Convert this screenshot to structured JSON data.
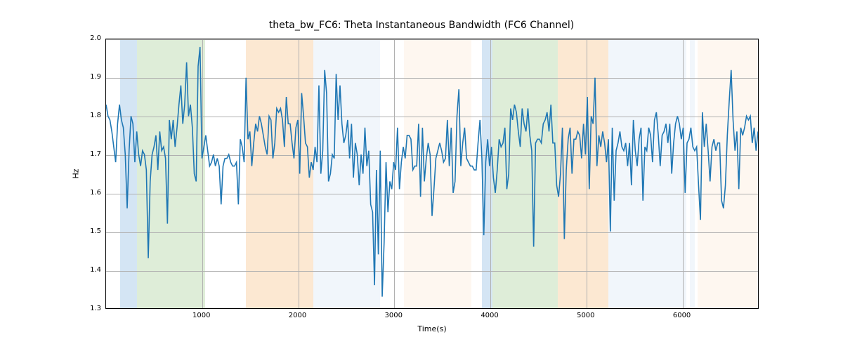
{
  "chart_data": {
    "type": "line",
    "title": "theta_bw_FC6: Theta Instantaneous Bandwidth (FC6 Channel)",
    "xlabel": "Time(s)",
    "ylabel": "Hz",
    "xlim": [
      0,
      6800
    ],
    "ylim": [
      1.3,
      2.0
    ],
    "xticks": [
      1000,
      2000,
      3000,
      4000,
      5000,
      6000
    ],
    "yticks": [
      1.3,
      1.4,
      1.5,
      1.6,
      1.7,
      1.8,
      1.9,
      2.0
    ],
    "bands": [
      {
        "x0": 145,
        "x1": 320,
        "color": "#6fa8dc"
      },
      {
        "x0": 320,
        "x1": 1030,
        "color": "#93c47d"
      },
      {
        "x0": 1455,
        "x1": 2155,
        "color": "#f6b26b"
      },
      {
        "x0": 2155,
        "x1": 2850,
        "color": "#cfe2f3"
      },
      {
        "x0": 3100,
        "x1": 3805,
        "color": "#fbe4cd"
      },
      {
        "x0": 3915,
        "x1": 4025,
        "color": "#6fa8dc"
      },
      {
        "x0": 4025,
        "x1": 4705,
        "color": "#93c47d"
      },
      {
        "x0": 4705,
        "x1": 5225,
        "color": "#f6b26b"
      },
      {
        "x0": 5225,
        "x1": 6040,
        "color": "#cfe2f3"
      },
      {
        "x0": 6075,
        "x1": 6125,
        "color": "#cfe2f3"
      },
      {
        "x0": 6155,
        "x1": 6800,
        "color": "#fbe4cd"
      }
    ],
    "x": [
      0,
      20,
      40,
      60,
      80,
      100,
      120,
      140,
      160,
      180,
      200,
      220,
      240,
      260,
      280,
      300,
      320,
      340,
      360,
      380,
      400,
      420,
      440,
      460,
      480,
      500,
      520,
      540,
      560,
      580,
      600,
      620,
      640,
      660,
      680,
      700,
      720,
      740,
      760,
      780,
      800,
      820,
      840,
      860,
      880,
      900,
      920,
      940,
      960,
      980,
      1000,
      1020,
      1040,
      1060,
      1080,
      1100,
      1120,
      1140,
      1160,
      1180,
      1200,
      1220,
      1240,
      1260,
      1280,
      1300,
      1320,
      1340,
      1360,
      1380,
      1400,
      1420,
      1440,
      1460,
      1480,
      1500,
      1520,
      1540,
      1560,
      1580,
      1600,
      1620,
      1640,
      1660,
      1680,
      1700,
      1720,
      1740,
      1760,
      1780,
      1800,
      1820,
      1840,
      1860,
      1880,
      1900,
      1920,
      1940,
      1960,
      1980,
      2000,
      2020,
      2040,
      2060,
      2080,
      2100,
      2120,
      2140,
      2160,
      2180,
      2200,
      2220,
      2240,
      2260,
      2280,
      2300,
      2320,
      2340,
      2360,
      2380,
      2400,
      2420,
      2440,
      2460,
      2480,
      2500,
      2520,
      2540,
      2560,
      2580,
      2600,
      2620,
      2640,
      2660,
      2680,
      2700,
      2720,
      2740,
      2760,
      2780,
      2800,
      2820,
      2840,
      2860,
      2880,
      2900,
      2920,
      2940,
      2960,
      2980,
      3000,
      3020,
      3040,
      3060,
      3080,
      3100,
      3120,
      3140,
      3160,
      3180,
      3200,
      3220,
      3240,
      3260,
      3280,
      3300,
      3320,
      3340,
      3360,
      3380,
      3400,
      3420,
      3440,
      3460,
      3480,
      3500,
      3520,
      3540,
      3560,
      3580,
      3600,
      3620,
      3640,
      3660,
      3680,
      3700,
      3720,
      3740,
      3760,
      3780,
      3800,
      3820,
      3840,
      3860,
      3880,
      3900,
      3920,
      3940,
      3960,
      3980,
      4000,
      4020,
      4040,
      4060,
      4080,
      4100,
      4120,
      4140,
      4160,
      4180,
      4200,
      4220,
      4240,
      4260,
      4280,
      4300,
      4320,
      4340,
      4360,
      4380,
      4400,
      4420,
      4440,
      4460,
      4480,
      4500,
      4520,
      4540,
      4560,
      4580,
      4600,
      4620,
      4640,
      4660,
      4680,
      4700,
      4720,
      4740,
      4760,
      4780,
      4800,
      4820,
      4840,
      4860,
      4880,
      4900,
      4920,
      4940,
      4960,
      4980,
      5000,
      5020,
      5040,
      5060,
      5080,
      5100,
      5120,
      5140,
      5160,
      5180,
      5200,
      5220,
      5240,
      5260,
      5280,
      5300,
      5320,
      5340,
      5360,
      5380,
      5400,
      5420,
      5440,
      5460,
      5480,
      5500,
      5520,
      5540,
      5560,
      5580,
      5600,
      5620,
      5640,
      5660,
      5680,
      5700,
      5720,
      5740,
      5760,
      5780,
      5800,
      5820,
      5840,
      5860,
      5880,
      5900,
      5920,
      5940,
      5960,
      5980,
      6000,
      6020,
      6040,
      6060,
      6080,
      6100,
      6120,
      6140,
      6160,
      6180,
      6200,
      6220,
      6240,
      6260,
      6280,
      6300,
      6320,
      6340,
      6360,
      6380,
      6400,
      6420,
      6440,
      6460,
      6480,
      6500,
      6520,
      6540,
      6560,
      6580,
      6600,
      6620,
      6640,
      6660,
      6680,
      6700,
      6720,
      6740,
      6760,
      6780,
      6800
    ],
    "values": [
      1.83,
      1.8,
      1.79,
      1.76,
      1.72,
      1.68,
      1.78,
      1.83,
      1.79,
      1.77,
      1.7,
      1.56,
      1.71,
      1.8,
      1.78,
      1.68,
      1.76,
      1.7,
      1.67,
      1.71,
      1.7,
      1.66,
      1.43,
      1.63,
      1.7,
      1.72,
      1.75,
      1.66,
      1.76,
      1.71,
      1.72,
      1.69,
      1.52,
      1.79,
      1.74,
      1.79,
      1.72,
      1.77,
      1.83,
      1.88,
      1.78,
      1.83,
      1.94,
      1.8,
      1.83,
      1.77,
      1.65,
      1.63,
      1.93,
      1.98,
      1.69,
      1.72,
      1.75,
      1.71,
      1.67,
      1.68,
      1.7,
      1.67,
      1.69,
      1.67,
      1.57,
      1.67,
      1.69,
      1.69,
      1.7,
      1.68,
      1.67,
      1.67,
      1.68,
      1.57,
      1.74,
      1.72,
      1.68,
      1.9,
      1.74,
      1.76,
      1.67,
      1.73,
      1.78,
      1.76,
      1.8,
      1.78,
      1.75,
      1.72,
      1.7,
      1.8,
      1.79,
      1.69,
      1.73,
      1.82,
      1.81,
      1.82,
      1.79,
      1.72,
      1.85,
      1.78,
      1.78,
      1.73,
      1.69,
      1.77,
      1.79,
      1.65,
      1.86,
      1.8,
      1.73,
      1.72,
      1.64,
      1.68,
      1.66,
      1.72,
      1.68,
      1.88,
      1.65,
      1.71,
      1.92,
      1.86,
      1.63,
      1.65,
      1.7,
      1.69,
      1.91,
      1.79,
      1.88,
      1.78,
      1.73,
      1.75,
      1.79,
      1.69,
      1.78,
      1.64,
      1.73,
      1.7,
      1.62,
      1.7,
      1.65,
      1.77,
      1.67,
      1.71,
      1.57,
      1.55,
      1.36,
      1.66,
      1.44,
      1.71,
      1.33,
      1.47,
      1.68,
      1.55,
      1.63,
      1.61,
      1.68,
      1.66,
      1.77,
      1.61,
      1.68,
      1.72,
      1.69,
      1.75,
      1.75,
      1.74,
      1.66,
      1.67,
      1.67,
      1.78,
      1.59,
      1.77,
      1.63,
      1.69,
      1.73,
      1.7,
      1.54,
      1.61,
      1.69,
      1.71,
      1.73,
      1.71,
      1.68,
      1.69,
      1.79,
      1.67,
      1.77,
      1.6,
      1.63,
      1.8,
      1.87,
      1.67,
      1.73,
      1.77,
      1.69,
      1.68,
      1.67,
      1.67,
      1.66,
      1.66,
      1.73,
      1.79,
      1.69,
      1.49,
      1.68,
      1.74,
      1.67,
      1.72,
      1.64,
      1.6,
      1.66,
      1.74,
      1.72,
      1.73,
      1.77,
      1.61,
      1.65,
      1.82,
      1.79,
      1.83,
      1.81,
      1.76,
      1.72,
      1.82,
      1.78,
      1.76,
      1.82,
      1.75,
      1.71,
      1.46,
      1.73,
      1.74,
      1.74,
      1.73,
      1.78,
      1.79,
      1.81,
      1.76,
      1.83,
      1.73,
      1.73,
      1.62,
      1.59,
      1.65,
      1.77,
      1.48,
      1.66,
      1.74,
      1.77,
      1.65,
      1.74,
      1.74,
      1.76,
      1.75,
      1.69,
      1.78,
      1.7,
      1.85,
      1.61,
      1.8,
      1.78,
      1.9,
      1.67,
      1.75,
      1.72,
      1.76,
      1.73,
      1.68,
      1.74,
      1.5,
      1.77,
      1.58,
      1.71,
      1.73,
      1.76,
      1.72,
      1.71,
      1.73,
      1.67,
      1.73,
      1.62,
      1.79,
      1.71,
      1.67,
      1.74,
      1.77,
      1.58,
      1.72,
      1.71,
      1.77,
      1.75,
      1.68,
      1.79,
      1.81,
      1.75,
      1.67,
      1.75,
      1.76,
      1.78,
      1.73,
      1.78,
      1.65,
      1.73,
      1.78,
      1.8,
      1.78,
      1.74,
      1.77,
      1.6,
      1.73,
      1.74,
      1.77,
      1.72,
      1.71,
      1.72,
      1.62,
      1.53,
      1.81,
      1.72,
      1.78,
      1.71,
      1.63,
      1.72,
      1.74,
      1.71,
      1.73,
      1.73,
      1.58,
      1.56,
      1.62,
      1.75,
      1.84,
      1.92,
      1.79,
      1.71,
      1.76,
      1.61,
      1.77,
      1.75,
      1.77,
      1.8,
      1.79,
      1.8,
      1.73,
      1.77,
      1.71,
      1.76
    ]
  }
}
